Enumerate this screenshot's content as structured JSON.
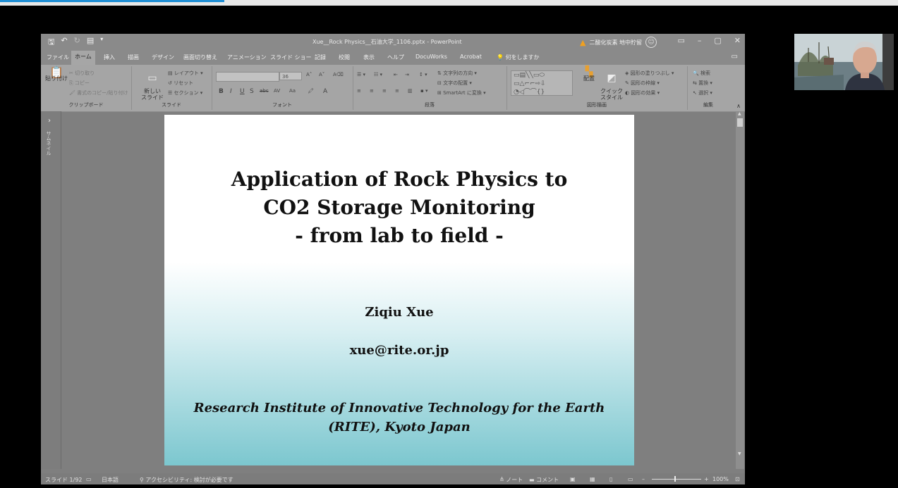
{
  "window": {
    "doc_title": "Xue__Rock Physics__石油大学_1106.pptx - PowerPoint",
    "account_label": "二酸化炭素 地中貯留",
    "qat_icons": [
      "save-icon",
      "undo-icon",
      "redo-icon",
      "present-from-start-icon",
      "customize-qat-icon"
    ]
  },
  "tabs": [
    "ファイル",
    "ホーム",
    "挿入",
    "描画",
    "デザイン",
    "画面切り替え",
    "アニメーション",
    "スライド ショー",
    "記録",
    "校閲",
    "表示",
    "ヘルプ",
    "DocuWorks",
    "Acrobat",
    "何をしますか"
  ],
  "ribbon": {
    "clipboard": {
      "paste": "貼り付け",
      "cut": "切り取り",
      "copy": "コピー",
      "format_painter": "書式のコピー/貼り付け",
      "label": "クリップボード"
    },
    "slides": {
      "new_slide": "新しい\nスライド",
      "layout": "レイアウト",
      "reset": "リセット",
      "section": "セクション",
      "label": "スライド"
    },
    "font": {
      "font_name": "",
      "font_size": "36",
      "label": "フォント",
      "style_buttons": [
        "B",
        "I",
        "U",
        "S",
        "abc",
        "AV",
        "Aa",
        "A"
      ]
    },
    "paragraph": {
      "text_direction": "文字列の方向",
      "align_text": "文字の配置",
      "smartart": "SmartArt に変換",
      "label": "段落"
    },
    "drawing": {
      "arrange": "配置",
      "quick_styles": "クイック\nスタイル",
      "shape_fill": "図形の塗りつぶし",
      "shape_outline": "図形の枠線",
      "shape_effects": "図形の効果",
      "label": "図形描画"
    },
    "editing": {
      "find": "検索",
      "replace": "置換",
      "select": "選択",
      "label": "編集"
    }
  },
  "sidebar": {
    "label": "サムネイル"
  },
  "slide": {
    "title_lines": [
      "Application of Rock Physics to",
      "CO2 Storage Monitoring",
      "- from lab to field -"
    ],
    "author": "Ziqiu Xue",
    "email": "xue@rite.or.jp",
    "institution_lines": [
      "Research Institute of Innovative Technology for the Earth",
      "(RITE), Kyoto Japan"
    ]
  },
  "status": {
    "slide_indicator": "スライド 1/92",
    "language": "日本語",
    "accessibility": "アクセシビリティ: 検討が必要です",
    "notes": "ノート",
    "comments": "コメント",
    "zoom": "100%"
  }
}
